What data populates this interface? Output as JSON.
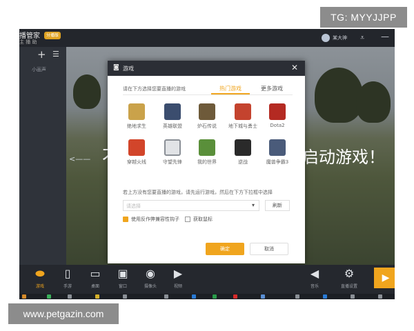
{
  "watermark_top": "TG: MYYJJPP",
  "watermark_bottom": "www.petgazin.com",
  "titlebar": {
    "app_title": "播管家",
    "badge": "分播版",
    "app_sub": "主 播 助",
    "user_name": "某大神",
    "menu_icon": "menu-icon",
    "min_icon": "minimize-icon"
  },
  "left_panel": {
    "add_icon": "plus-icon",
    "list_icon": "list-icon",
    "label": "小画声"
  },
  "scene": {
    "left_text": "才",
    "right_text": "启动游戏！"
  },
  "dialog": {
    "title": "游戏",
    "hint": "请在下方选择您要直播的游戏",
    "tabs": {
      "hot": "热门游戏",
      "more": "更多游戏"
    },
    "games": [
      {
        "name": "绝地求生",
        "color": "#caa24a",
        "icon": "pubg-icon"
      },
      {
        "name": "英雄联盟",
        "color": "#3b4d6e",
        "icon": "lol-icon"
      },
      {
        "name": "炉石传说",
        "color": "#6e5a3a",
        "icon": "hearthstone-icon"
      },
      {
        "name": "地下城与勇士",
        "color": "#c4432e",
        "icon": "dnf-icon"
      },
      {
        "name": "Dota2",
        "color": "#b42a22",
        "icon": "dota2-icon"
      },
      {
        "name": "穿越火线",
        "color": "#d2452a",
        "icon": "cf-icon"
      },
      {
        "name": "守望先锋",
        "color": "#e1e3e6",
        "icon": "overwatch-icon"
      },
      {
        "name": "我的世界",
        "color": "#5a8f3a",
        "icon": "minecraft-icon"
      },
      {
        "name": "逆战",
        "color": "#2a2a2a",
        "icon": "nz-icon"
      },
      {
        "name": "魔兽争霸3",
        "color": "#4a5b7a",
        "icon": "warcraft3-icon"
      }
    ],
    "note": "若上方没有您要直播的游戏，请先运行游戏，然后在下方下拉框中选择",
    "select_placeholder": "请选择",
    "refresh_label": "刷新",
    "checkbox1_label": "使用反作弊兼容性钩子",
    "checkbox2_label": "获取鼠标",
    "ok_label": "确定",
    "cancel_label": "取消"
  },
  "bottom_bar": {
    "items": [
      {
        "label": "游戏",
        "icon": "gamepad-icon",
        "glyph": "🎮"
      },
      {
        "label": "手游",
        "icon": "phone-icon",
        "glyph": "▯"
      },
      {
        "label": "桌面",
        "icon": "monitor-icon",
        "glyph": "▭"
      },
      {
        "label": "窗口",
        "icon": "window-icon",
        "glyph": "▣"
      },
      {
        "label": "摄像头",
        "icon": "camera-icon",
        "glyph": "◉"
      },
      {
        "label": "视频",
        "icon": "video-icon",
        "glyph": "▶"
      },
      {
        "label": "音乐",
        "icon": "speaker-icon",
        "glyph": "🔈"
      },
      {
        "label": "直播设置",
        "icon": "settings-icon",
        "glyph": "⚙"
      }
    ],
    "play_icon": "play-icon"
  },
  "colors": {
    "accent": "#f0a51e",
    "dark": "#2b2f36"
  }
}
